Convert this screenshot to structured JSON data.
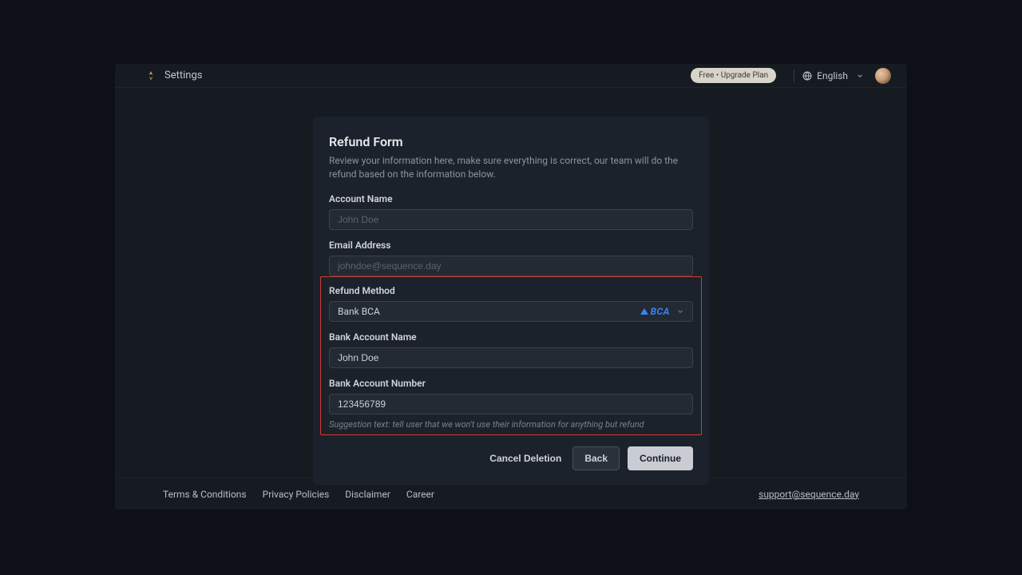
{
  "header": {
    "title": "Settings",
    "upgrade_label": "Free • Upgrade Plan",
    "language": "English"
  },
  "form": {
    "title": "Refund Form",
    "description": "Review your information here, make sure everything is correct, our team will do the refund based on the information below.",
    "account_name": {
      "label": "Account Name",
      "placeholder": "John Doe",
      "value": ""
    },
    "email": {
      "label": "Email Address",
      "placeholder": "johndoe@sequence.day",
      "value": ""
    },
    "refund_method": {
      "label": "Refund Method",
      "value": "Bank BCA",
      "logo_text": "BCA"
    },
    "bank_account_name": {
      "label": "Bank Account Name",
      "value": "John Doe"
    },
    "bank_account_number": {
      "label": "Bank Account Number",
      "value": "123456789"
    },
    "suggestion": "Suggestion text: tell user that we won't use their information for anything but refund",
    "buttons": {
      "cancel": "Cancel Deletion",
      "back": "Back",
      "continue": "Continue"
    }
  },
  "footer": {
    "links": [
      "Terms & Conditions",
      "Privacy Policies",
      "Disclaimer",
      "Career"
    ],
    "email": "support@sequence.day"
  }
}
